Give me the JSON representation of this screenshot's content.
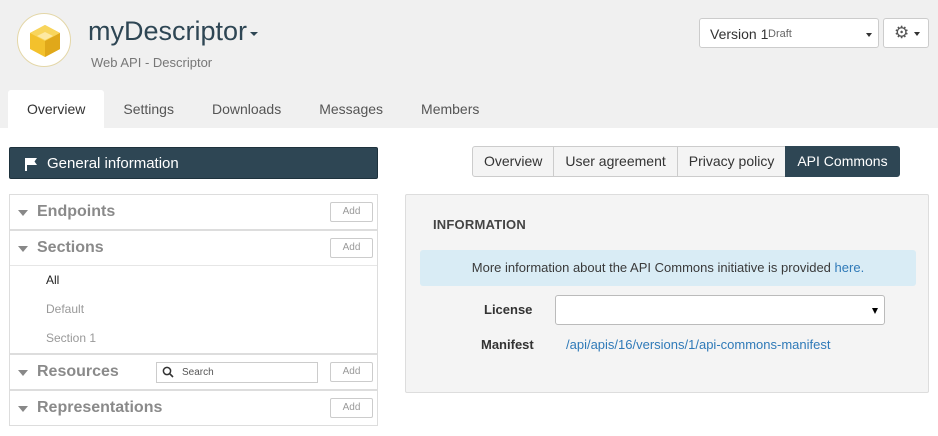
{
  "header": {
    "title": "myDescriptor",
    "subtitle": "Web API - Descriptor",
    "logo_icon": "hexagon-cube-icon",
    "brand_color": "#f0c330",
    "version": {
      "label": "Version 1",
      "status": "Draft"
    },
    "settings_icon": "gear-icon"
  },
  "main_tabs": [
    {
      "label": "Overview",
      "active": true
    },
    {
      "label": "Settings"
    },
    {
      "label": "Downloads"
    },
    {
      "label": "Messages"
    },
    {
      "label": "Members"
    }
  ],
  "sidebar": {
    "general_info": {
      "label": "General information",
      "icon": "flag-icon"
    },
    "panels": {
      "endpoints": {
        "title": "Endpoints",
        "add_label": "Add"
      },
      "sections": {
        "title": "Sections",
        "add_label": "Add",
        "items": [
          {
            "label": "All",
            "active": true
          },
          {
            "label": "Default"
          },
          {
            "label": "Section 1"
          }
        ]
      },
      "resources": {
        "title": "Resources",
        "add_label": "Add",
        "search_placeholder": "Search"
      },
      "representations": {
        "title": "Representations",
        "add_label": "Add"
      }
    }
  },
  "sub_tabs": [
    {
      "label": "Overview"
    },
    {
      "label": "User agreement"
    },
    {
      "label": "Privacy policy"
    },
    {
      "label": "API Commons",
      "active": true
    }
  ],
  "info": {
    "heading": "INFORMATION",
    "alert_text": "More information about the API Commons initiative is provided",
    "alert_link": "here.",
    "license_label": "License",
    "license_value": "",
    "manifest_label": "Manifest",
    "manifest_link": "/api/apis/16/versions/1/api-commons-manifest"
  },
  "colors": {
    "accent_dark": "#2e4654",
    "header_bg": "#f0f0f0",
    "link": "#2f7ab8",
    "alert_bg": "#d9ecf5"
  }
}
